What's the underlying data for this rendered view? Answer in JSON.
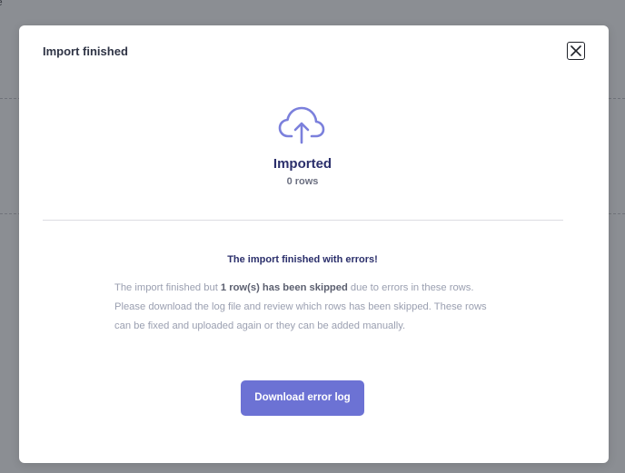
{
  "background": {
    "partial_text": "e"
  },
  "modal": {
    "title": "Import finished",
    "close_icon": "close-icon",
    "status_icon": "cloud-upload-icon",
    "status_title": "Imported",
    "rows_text": "0 rows",
    "error_heading": "The import finished with errors!",
    "message": {
      "part1": "The import finished but ",
      "emphasis": "1 row(s) has been skipped",
      "part2": " due to errors in these rows. Please download the log file and review which rows has been skipped. These rows can be fixed and uploaded again or they can be added manually."
    },
    "download_label": "Download error log"
  },
  "colors": {
    "accent": "#6c72d4",
    "heading": "#2b2f6b",
    "backdrop": "#8b8e93"
  }
}
